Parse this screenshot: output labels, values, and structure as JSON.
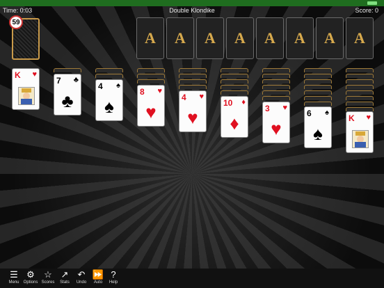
{
  "topbar": {
    "time": "Time: 0:03",
    "title": "Double Klondike",
    "score": "Score: 0"
  },
  "stock": {
    "count": "59"
  },
  "foundations": [
    "A",
    "A",
    "A",
    "A",
    "A",
    "A",
    "A",
    "A"
  ],
  "tableau": [
    {
      "rank": "K",
      "suit": "♥",
      "color": "red",
      "king": true,
      "hidden": 0
    },
    {
      "rank": "7",
      "suit": "♣",
      "color": "black",
      "king": false,
      "hidden": 1
    },
    {
      "rank": "4",
      "suit": "♠",
      "color": "black",
      "king": false,
      "hidden": 2
    },
    {
      "rank": "8",
      "suit": "♥",
      "color": "red",
      "king": false,
      "hidden": 3
    },
    {
      "rank": "4",
      "suit": "♥",
      "color": "red",
      "king": false,
      "hidden": 4
    },
    {
      "rank": "10",
      "suit": "♦",
      "color": "red",
      "king": false,
      "hidden": 5
    },
    {
      "rank": "3",
      "suit": "♥",
      "color": "red",
      "king": false,
      "hidden": 6
    },
    {
      "rank": "6",
      "suit": "♠",
      "color": "black",
      "king": false,
      "hidden": 7
    },
    {
      "rank": "K",
      "suit": "♥",
      "color": "red",
      "king": true,
      "hidden": 8
    }
  ],
  "toolbar": {
    "menu": "Menu",
    "options": "Options",
    "scores": "Scores",
    "stats": "Stats",
    "undo": "Undo",
    "auto": "Auto",
    "help": "Help"
  },
  "icons": {
    "menu": "menu-icon",
    "options": "gear-icon",
    "scores": "star-icon",
    "stats": "chart-icon",
    "undo": "undo-icon",
    "auto": "fast-forward-icon",
    "help": "help-icon"
  }
}
